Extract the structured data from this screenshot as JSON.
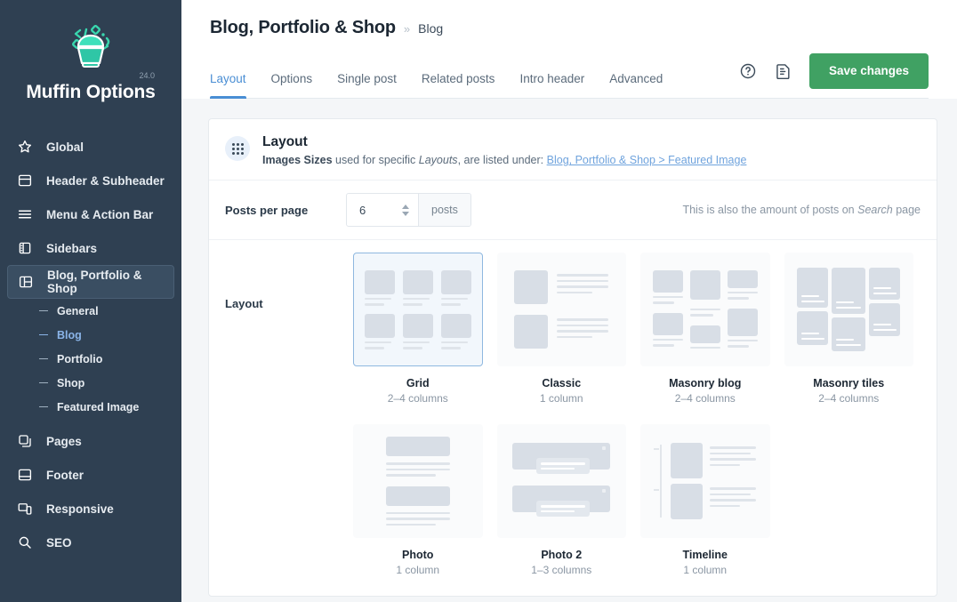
{
  "sidebar": {
    "brand": {
      "title": "Muffin Options",
      "version": "24.0",
      "logo_icon": "muffin-logo-icon"
    },
    "items": [
      {
        "label": "Global",
        "icon": "star-icon",
        "active": false
      },
      {
        "label": "Header & Subheader",
        "icon": "header-panel-icon",
        "active": false
      },
      {
        "label": "Menu & Action Bar",
        "icon": "hamburger-menu-icon",
        "active": false
      },
      {
        "label": "Sidebars",
        "icon": "sidebar-layout-icon",
        "active": false
      },
      {
        "label": "Blog, Portfolio & Shop",
        "icon": "columns-layout-icon",
        "active": true
      }
    ],
    "sub_items": [
      {
        "label": "General",
        "current": false
      },
      {
        "label": "Blog",
        "current": true
      },
      {
        "label": "Portfolio",
        "current": false
      },
      {
        "label": "Shop",
        "current": false
      },
      {
        "label": "Featured Image",
        "current": false
      }
    ],
    "items_bottom": [
      {
        "label": "Pages",
        "icon": "copy-pages-icon"
      },
      {
        "label": "Footer",
        "icon": "footer-panel-icon"
      },
      {
        "label": "Responsive",
        "icon": "devices-icon"
      },
      {
        "label": "SEO",
        "icon": "magnifier-icon"
      }
    ]
  },
  "header": {
    "breadcrumb_main": "Blog, Portfolio & Shop",
    "breadcrumb_sep": "»",
    "breadcrumb_sub": "Blog",
    "tabs": [
      {
        "label": "Layout",
        "active": true
      },
      {
        "label": "Options",
        "active": false
      },
      {
        "label": "Single post",
        "active": false
      },
      {
        "label": "Related posts",
        "active": false
      },
      {
        "label": "Intro header",
        "active": false
      },
      {
        "label": "Advanced",
        "active": false
      }
    ],
    "help_icon": "question-circle-icon",
    "notes_icon": "document-note-icon",
    "save_label": "Save changes",
    "save_color": "#40a163"
  },
  "panel": {
    "drag_icon": "drag-dots-icon",
    "title": "Layout",
    "desc_bold": "Images Sizes",
    "desc_mid": " used for specific ",
    "desc_italic": "Layouts",
    "desc_mid2": ", are listed under: ",
    "desc_link": "Blog, Portfolio & Shop > Featured Image",
    "posts_per_page": {
      "label": "Posts per page",
      "value": "6",
      "unit": "posts",
      "hint_pre": "This is also the amount of posts on ",
      "hint_italic": "Search",
      "hint_post": " page"
    },
    "layout": {
      "label": "Layout",
      "options": [
        {
          "name": "Grid",
          "sub": "2–4 columns",
          "thumb": "grid",
          "selected": true
        },
        {
          "name": "Classic",
          "sub": "1 column",
          "thumb": "classic",
          "selected": false
        },
        {
          "name": "Masonry blog",
          "sub": "2–4 columns",
          "thumb": "masonry-blog",
          "selected": false
        },
        {
          "name": "Masonry tiles",
          "sub": "2–4 columns",
          "thumb": "masonry-tiles",
          "selected": false
        },
        {
          "name": "Photo",
          "sub": "1 column",
          "thumb": "photo",
          "selected": false
        },
        {
          "name": "Photo 2",
          "sub": "1–3 columns",
          "thumb": "photo2",
          "selected": false
        },
        {
          "name": "Timeline",
          "sub": "1 column",
          "thumb": "timeline",
          "selected": false
        }
      ]
    }
  },
  "colors": {
    "sidebar_bg": "#2f4052",
    "accent_blue": "#4a8ed4",
    "save_green": "#40a163",
    "page_bg": "#f4f6f8"
  }
}
